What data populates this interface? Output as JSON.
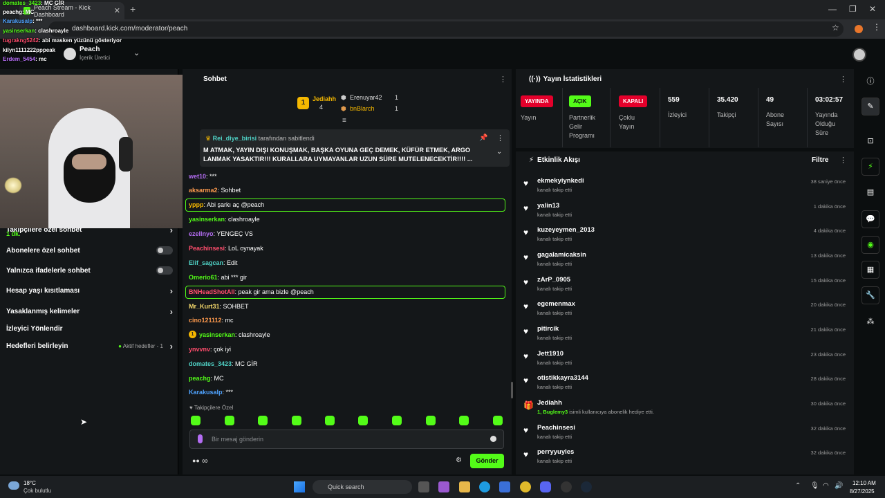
{
  "browser": {
    "tab_title": "Peach Stream - Kick Dashboard",
    "url": "dashboard.kick.com/moderator/peach",
    "new_tab": "+",
    "close": "✕"
  },
  "channel": {
    "name": "Peach",
    "role": "İçerik Üretici"
  },
  "overlay_chat": [
    {
      "user": "domates_3423",
      "text": ": MC GİR",
      "color": "#53fc18"
    },
    {
      "user": "peachg",
      "text": ": MC",
      "color": "#ffffff"
    },
    {
      "user": "Karakusalp",
      "text": ": ***",
      "color": "#4fa3ff"
    },
    {
      "user": "yasinserkan",
      "text": ": clashroayle",
      "color": "#53fc18"
    },
    {
      "user": "tugrakng5242",
      "text": ": abi masken yüzünü gösteriyor",
      "color": "#ff4d6d"
    },
    {
      "user": "kilyn1111222",
      "text": "pppeak",
      "color": "#ffffff"
    },
    {
      "user": "Erdem_5454",
      "text": ": mc",
      "color": "#b46df3"
    }
  ],
  "left_settings": {
    "partial_label": "Takipçilere özel sohbet",
    "partial_value": "1 dk.",
    "subs_only": "Abonelere özel sohbet",
    "emote_only": "Yalnızca ifadelerle sohbet",
    "age_limit": "Hesap yaşı kısıtlaması",
    "banned_words": "Yasaklanmış kelimeler",
    "viewer_guide": "İzleyici Yönlendir",
    "goals": "Hedefleri belirleyin",
    "goals_active": "Aktif hedefler - 1"
  },
  "chat": {
    "title": "Sohbet",
    "leaderboard": [
      {
        "rank": "1",
        "name": "Jediahh",
        "count": "4"
      },
      {
        "rank": "2",
        "name": "Erenuyar42",
        "count": "1"
      },
      {
        "rank": "3",
        "name": "bnBlarch",
        "count": "1"
      }
    ],
    "pinned_by_user": "Rei_diye_birisi",
    "pinned_by_text": "tarafından sabitlendi",
    "pinned_line1": "M ATMAK, YAYIN DIŞI KONUŞMAK, BAŞKA OYUNA GEÇ DEMEK, KÜFÜR ETMEK, ARGO",
    "pinned_line2": "LANMAK YASAKTIR!!! KURALLARA UYMAYANLAR UZUN SÜRE MUTELENECEKTİR!!!!",
    "pinned_more": "...",
    "messages": [
      {
        "user": "wet10",
        "text": ": ***",
        "color": "#b46df3"
      },
      {
        "user": "aksarma2",
        "text": ": Sohbet",
        "color": "#ff9a4d"
      },
      {
        "user": "yppp",
        "text": ": Abi şarkı aç @peach",
        "color": "#f5b800"
      },
      {
        "user": "yasinserkan",
        "text": ": clashroayle",
        "color": "#53fc18"
      },
      {
        "user": "ezellnyo",
        "text": ": YENGEÇ VS",
        "color": "#b46df3"
      },
      {
        "user": "Peachinsesi",
        "text": ": LoL oynayak",
        "color": "#ff4d6d"
      },
      {
        "user": "Elif_sagcan",
        "text": ": Edit",
        "color": "#4fd1c5"
      },
      {
        "user": "Omerio61",
        "text": ": abi *** gir",
        "color": "#53fc18"
      },
      {
        "user": "BNHeadShotAll",
        "text": ": peak gir ama bizle @peach",
        "color": "#ff4d6d"
      },
      {
        "user": "Mr_Kurt31",
        "text": ": SOHBET",
        "color": "#f5d96b"
      },
      {
        "user": "cino121112",
        "text": ": mc",
        "color": "#ff9a4d"
      },
      {
        "user": "yasinserkan",
        "text": ": clashroayle",
        "color": "#53fc18"
      },
      {
        "user": "ynvvnv",
        "text": ": çok iyi",
        "color": "#ff4d6d"
      },
      {
        "user": "domates_3423",
        "text": ": MC GİR",
        "color": "#4fd1c5"
      },
      {
        "user": "peachg",
        "text": ": MC",
        "color": "#53fc18"
      },
      {
        "user": "Karakusalp",
        "text": ": ***",
        "color": "#4fa3ff"
      }
    ],
    "follower_only": "Takipçilere Özel",
    "input_placeholder": "Bir mesaj gönderin",
    "send_label": "Gönder"
  },
  "stats": {
    "title": "Yayın İstatistikleri",
    "live_badge": "YAYINDA",
    "live_label": "Yayın",
    "partner_badge": "AÇIK",
    "partner_label": [
      "Partnerlik",
      "Gelir",
      "Programı"
    ],
    "multi_badge": "KAPALI",
    "multi_label": [
      "Çoklu",
      "Yayın"
    ],
    "viewers": "559",
    "viewers_label": "İzleyici",
    "followers": "35.420",
    "followers_label": "Takipçi",
    "subs": "49",
    "subs_label": [
      "Abone",
      "Sayısı"
    ],
    "duration": "03:02:57",
    "duration_label": [
      "Yayında",
      "Olduğu",
      "Süre"
    ]
  },
  "activity": {
    "title": "Etkinlik Akışı",
    "filter": "Filtre",
    "items": [
      {
        "name": "ekmekyiynkedi",
        "sub": "kanalı takip etti",
        "time": "38 saniye önce",
        "icon": "heart"
      },
      {
        "name": "yalin13",
        "sub": "kanalı takip etti",
        "time": "1 dakika önce",
        "icon": "heart"
      },
      {
        "name": "kuzeyeymen_2013",
        "sub": "kanalı takip etti",
        "time": "4 dakika önce",
        "icon": "heart"
      },
      {
        "name": "gagalamicaksin",
        "sub": "kanalı takip etti",
        "time": "13 dakika önce",
        "icon": "heart"
      },
      {
        "name": "zArP_0905",
        "sub": "kanalı takip etti",
        "time": "15 dakika önce",
        "icon": "heart"
      },
      {
        "name": "egemenmax",
        "sub": "kanalı takip etti",
        "time": "20 dakika önce",
        "icon": "heart"
      },
      {
        "name": "pitircik",
        "sub": "kanalı takip etti",
        "time": "21 dakika önce",
        "icon": "heart"
      },
      {
        "name": "Jett1910",
        "sub": "kanalı takip etti",
        "time": "23 dakika önce",
        "icon": "heart"
      },
      {
        "name": "otistikkayra3144",
        "sub": "kanalı takip etti",
        "time": "28 dakika önce",
        "icon": "heart"
      },
      {
        "name": "Jediahh",
        "sub_highlight": "1, Buglemy3",
        "sub": "isimli kullanıcıya abonelik hediye etti.",
        "time": "30 dakika önce",
        "icon": "gift"
      },
      {
        "name": "Peachinsesi",
        "sub": "kanalı takip etti",
        "time": "32 dakika önce",
        "icon": "heart"
      },
      {
        "name": "perryyuyles",
        "sub": "kanalı takip etti",
        "time": "32 dakika önce",
        "icon": "heart"
      }
    ]
  },
  "taskbar": {
    "temp": "18°C",
    "weather": "Çok bulutlu",
    "search": "Quick search",
    "time": "12:10 AM",
    "date": "8/27/2025"
  },
  "colors": {
    "accent": "#53fc18",
    "live": "#e4002b",
    "panel": "#141719",
    "bg": "#0b0e0f"
  }
}
